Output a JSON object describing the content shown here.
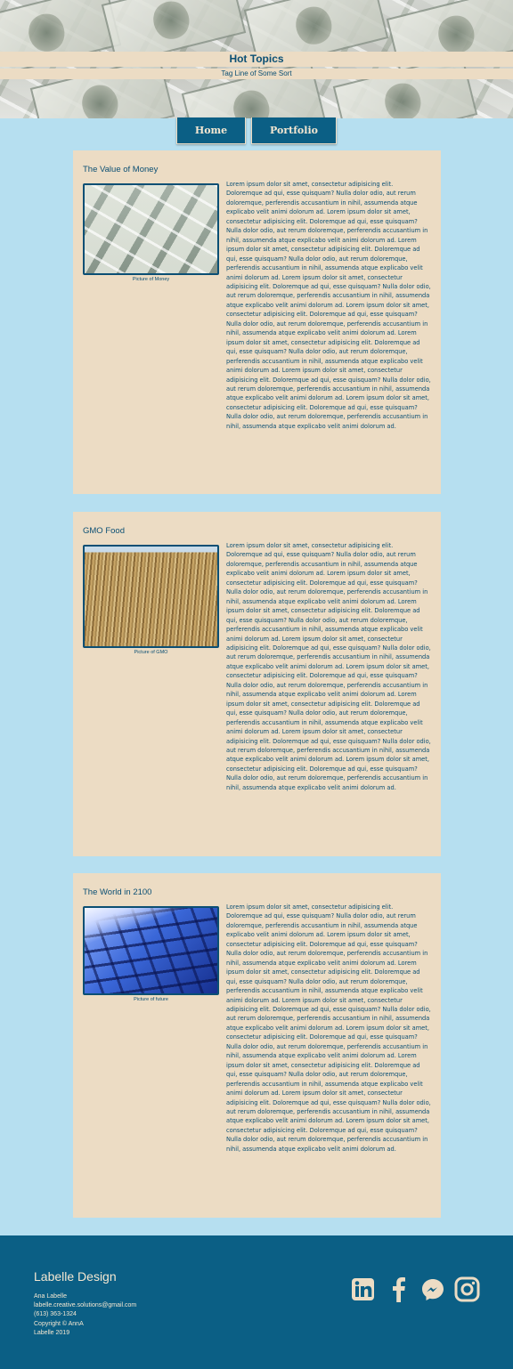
{
  "header": {
    "title": "Hot Topics",
    "tagline": "Tag Line of Some Sort"
  },
  "nav": {
    "home": "Home",
    "portfolio": "Portfolio"
  },
  "articles": [
    {
      "title": "The Value of Money",
      "caption": "Picture of Money",
      "body": "Lorem ipsum dolor sit amet, consectetur adipisicing elit. Doloremque ad qui, esse quisquam? Nulla dolor odio, aut rerum doloremque, perferendis accusantium in nihil, assumenda atque explicabo velit animi dolorum ad. Lorem ipsum dolor sit amet, consectetur adipisicing elit. Doloremque ad qui, esse quisquam? Nulla dolor odio, aut rerum doloremque, perferendis accusantium in nihil, assumenda atque explicabo velit animi dolorum ad. Lorem ipsum dolor sit amet, consectetur adipisicing elit. Doloremque ad qui, esse quisquam? Nulla dolor odio, aut rerum doloremque, perferendis accusantium in nihil, assumenda atque explicabo velit animi dolorum ad. Lorem ipsum dolor sit amet, consectetur adipisicing elit. Doloremque ad qui, esse quisquam? Nulla dolor odio, aut rerum doloremque, perferendis accusantium in nihil, assumenda atque explicabo velit animi dolorum ad. Lorem ipsum dolor sit amet, consectetur adipisicing elit. Doloremque ad qui, esse quisquam? Nulla dolor odio, aut rerum doloremque, perferendis accusantium in nihil, assumenda atque explicabo velit animi dolorum ad. Lorem ipsum dolor sit amet, consectetur adipisicing elit. Doloremque ad qui, esse quisquam? Nulla dolor odio, aut rerum doloremque, perferendis accusantium in nihil, assumenda atque explicabo velit animi dolorum ad. Lorem ipsum dolor sit amet, consectetur adipisicing elit. Doloremque ad qui, esse quisquam? Nulla dolor odio, aut rerum doloremque, perferendis accusantium in nihil, assumenda atque explicabo velit animi dolorum ad. Lorem ipsum dolor sit amet, consectetur adipisicing elit. Doloremque ad qui, esse quisquam? Nulla dolor odio, aut rerum doloremque, perferendis accusantium in nihil, assumenda atque explicabo velit animi dolorum ad."
    },
    {
      "title": "GMO Food",
      "caption": "Picture of GMO",
      "body": "Lorem ipsum dolor sit amet, consectetur adipisicing elit. Doloremque ad qui, esse quisquam? Nulla dolor odio, aut rerum doloremque, perferendis accusantium in nihil, assumenda atque explicabo velit animi dolorum ad. Lorem ipsum dolor sit amet, consectetur adipisicing elit. Doloremque ad qui, esse quisquam? Nulla dolor odio, aut rerum doloremque, perferendis accusantium in nihil, assumenda atque explicabo velit animi dolorum ad. Lorem ipsum dolor sit amet, consectetur adipisicing elit. Doloremque ad qui, esse quisquam? Nulla dolor odio, aut rerum doloremque, perferendis accusantium in nihil, assumenda atque explicabo velit animi dolorum ad. Lorem ipsum dolor sit amet, consectetur adipisicing elit. Doloremque ad qui, esse quisquam? Nulla dolor odio, aut rerum doloremque, perferendis accusantium in nihil, assumenda atque explicabo velit animi dolorum ad. Lorem ipsum dolor sit amet, consectetur adipisicing elit. Doloremque ad qui, esse quisquam? Nulla dolor odio, aut rerum doloremque, perferendis accusantium in nihil, assumenda atque explicabo velit animi dolorum ad. Lorem ipsum dolor sit amet, consectetur adipisicing elit. Doloremque ad qui, esse quisquam? Nulla dolor odio, aut rerum doloremque, perferendis accusantium in nihil, assumenda atque explicabo velit animi dolorum ad. Lorem ipsum dolor sit amet, consectetur adipisicing elit. Doloremque ad qui, esse quisquam? Nulla dolor odio, aut rerum doloremque, perferendis accusantium in nihil, assumenda atque explicabo velit animi dolorum ad. Lorem ipsum dolor sit amet, consectetur adipisicing elit. Doloremque ad qui, esse quisquam? Nulla dolor odio, aut rerum doloremque, perferendis accusantium in nihil, assumenda atque explicabo velit animi dolorum ad."
    },
    {
      "title": "The World in 2100",
      "caption": "Picture of future",
      "body": "Lorem ipsum dolor sit amet, consectetur adipisicing elit. Doloremque ad qui, esse quisquam? Nulla dolor odio, aut rerum doloremque, perferendis accusantium in nihil, assumenda atque explicabo velit animi dolorum ad. Lorem ipsum dolor sit amet, consectetur adipisicing elit. Doloremque ad qui, esse quisquam? Nulla dolor odio, aut rerum doloremque, perferendis accusantium in nihil, assumenda atque explicabo velit animi dolorum ad. Lorem ipsum dolor sit amet, consectetur adipisicing elit. Doloremque ad qui, esse quisquam? Nulla dolor odio, aut rerum doloremque, perferendis accusantium in nihil, assumenda atque explicabo velit animi dolorum ad. Lorem ipsum dolor sit amet, consectetur adipisicing elit. Doloremque ad qui, esse quisquam? Nulla dolor odio, aut rerum doloremque, perferendis accusantium in nihil, assumenda atque explicabo velit animi dolorum ad. Lorem ipsum dolor sit amet, consectetur adipisicing elit. Doloremque ad qui, esse quisquam? Nulla dolor odio, aut rerum doloremque, perferendis accusantium in nihil, assumenda atque explicabo velit animi dolorum ad. Lorem ipsum dolor sit amet, consectetur adipisicing elit. Doloremque ad qui, esse quisquam? Nulla dolor odio, aut rerum doloremque, perferendis accusantium in nihil, assumenda atque explicabo velit animi dolorum ad. Lorem ipsum dolor sit amet, consectetur adipisicing elit. Doloremque ad qui, esse quisquam? Nulla dolor odio, aut rerum doloremque, perferendis accusantium in nihil, assumenda atque explicabo velit animi dolorum ad. Lorem ipsum dolor sit amet, consectetur adipisicing elit. Doloremque ad qui, esse quisquam? Nulla dolor odio, aut rerum doloremque, perferendis accusantium in nihil, assumenda atque explicabo velit animi dolorum ad."
    }
  ],
  "footer": {
    "brand": "Labelle Design",
    "name": "Ana Labelle",
    "email": "labelle.creative.solutions@gmail.com",
    "phone": "(613) 363-1324",
    "copyright": "Copyright © AnnA",
    "year_line": "Labelle 2019",
    "socials": [
      "linkedin-icon",
      "facebook-icon",
      "messenger-icon",
      "instagram-icon"
    ]
  },
  "colors": {
    "page_bg": "#b6dff0",
    "card_bg": "#ecdcc4",
    "primary": "#0b5f85",
    "text": "#0b4f74"
  }
}
